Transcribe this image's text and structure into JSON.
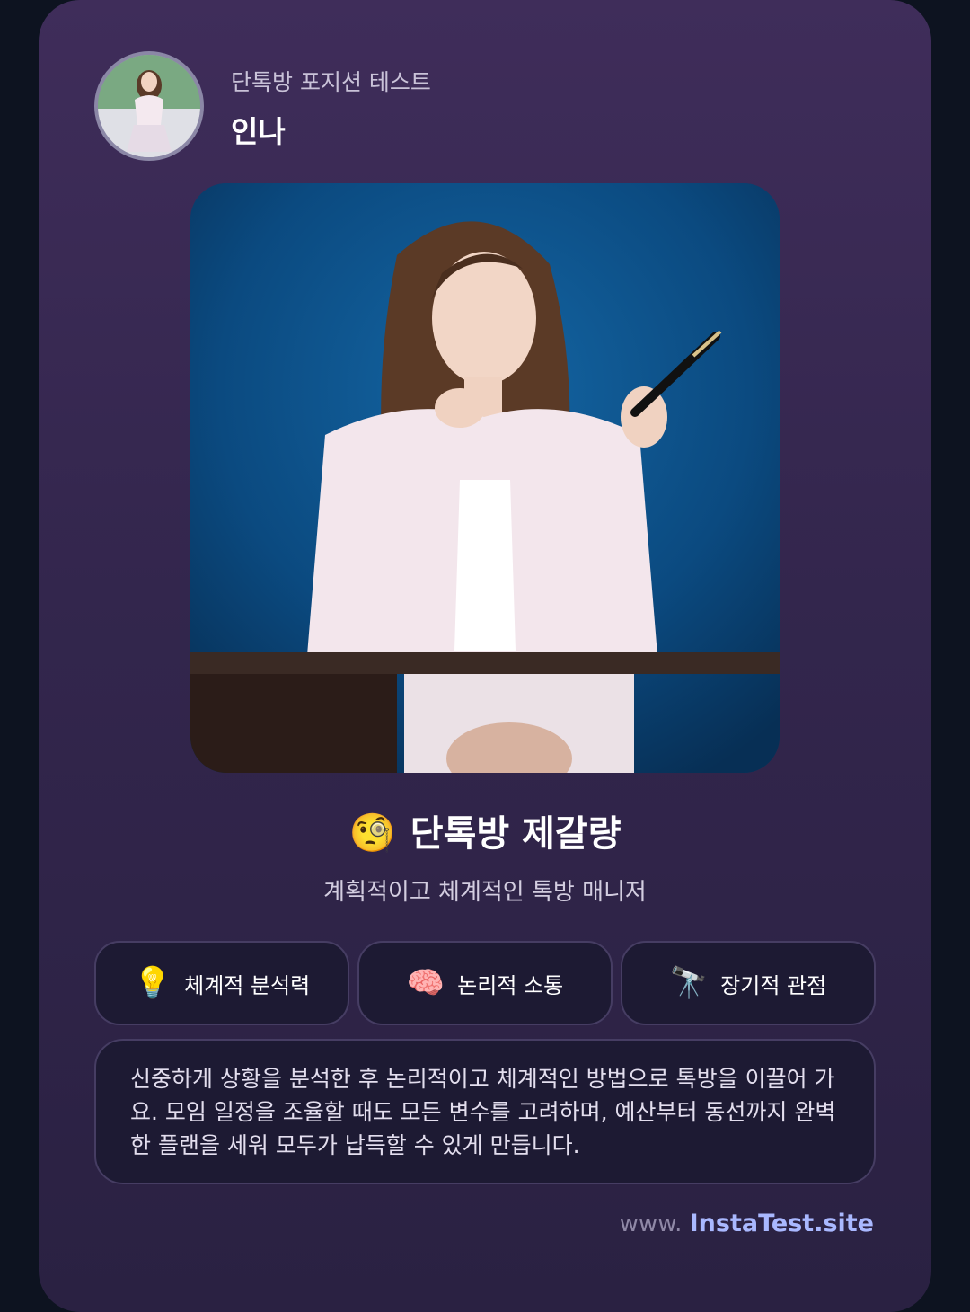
{
  "header": {
    "subtitle": "단톡방 포지션 테스트",
    "name": "인나"
  },
  "result": {
    "emoji": "🧐",
    "title": "단톡방 제갈량",
    "subtitle": "계획적이고 체계적인 톡방 매니저"
  },
  "traits": [
    {
      "icon": "💡",
      "icon_name": "lightbulb-icon",
      "label": "체계적 분석력"
    },
    {
      "icon": "🧠",
      "icon_name": "brain-icon",
      "label": "논리적 소통"
    },
    {
      "icon": "🔭",
      "icon_name": "telescope-icon",
      "label": "장기적 관점"
    }
  ],
  "description": "신중하게 상황을 분석한 후 논리적이고 체계적인 방법으로 톡방을 이끌어 가요. 모임 일정을 조율할 때도 모든 변수를 고려하며, 예산부터 동선까지 완벽한 플랜을 세워 모두가 납득할 수 있게 만듭니다.",
  "footer": {
    "prefix": "www.",
    "brand": "InstaTest.site"
  },
  "colors": {
    "card_top": "#3f2d5a",
    "card_bottom": "#2a2142",
    "hero_background": "#0b4a80",
    "chip_background": "#1d1a33",
    "brand_accent": "#a9b8ff"
  }
}
